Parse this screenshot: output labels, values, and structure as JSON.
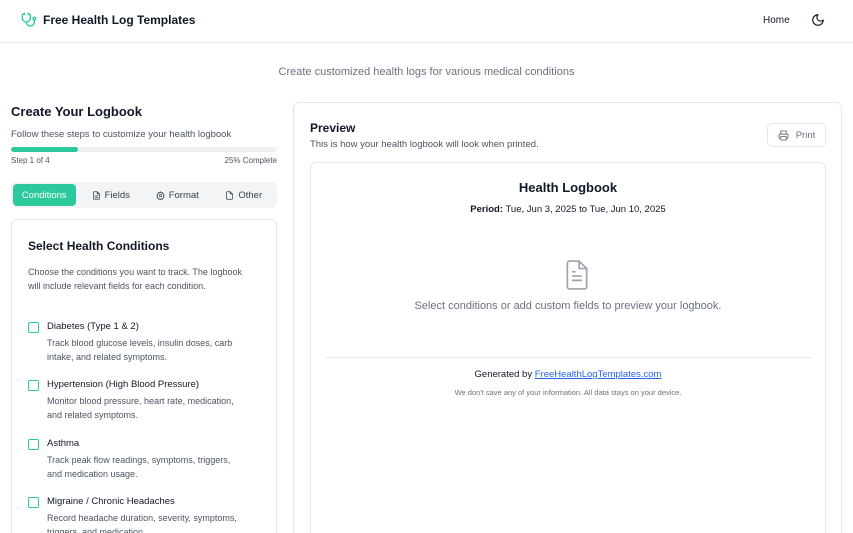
{
  "header": {
    "brand": "Free Health Log Templates",
    "brand_icon": "stethoscope-icon",
    "nav_home": "Home",
    "theme_icon": "moon-icon"
  },
  "subtitle": "Create customized health logs for various medical conditions",
  "builder": {
    "title": "Create Your Logbook",
    "description": "Follow these steps to customize your health logbook",
    "progress": 0.25,
    "step_label": "Step 1 of 4",
    "complete_label": "25% Complete",
    "tabs": [
      {
        "label": "Conditions",
        "icon": "",
        "active": true
      },
      {
        "label": "Fields",
        "icon": "file-icon",
        "active": false
      },
      {
        "label": "Format",
        "icon": "gear-icon",
        "active": false
      },
      {
        "label": "Other",
        "icon": "document-icon",
        "active": false
      }
    ]
  },
  "conditions_card": {
    "title": "Select Health Conditions",
    "description": "Choose the conditions you want to track. The logbook will include relevant fields for each condition.",
    "items": [
      {
        "name": "Diabetes (Type 1 & 2)",
        "desc": "Track blood glucose levels, insulin doses, carb intake, and related symptoms."
      },
      {
        "name": "Hypertension (High Blood Pressure)",
        "desc": "Monitor blood pressure, heart rate, medication, and related symptoms."
      },
      {
        "name": "Asthma",
        "desc": "Track peak flow readings, symptoms, triggers, and medication usage."
      },
      {
        "name": "Migraine / Chronic Headaches",
        "desc": "Record headache duration, severity, symptoms, triggers, and medication."
      }
    ]
  },
  "preview": {
    "title": "Preview",
    "description": "This is how your health logbook will look when printed.",
    "print_label": "Print",
    "logbook": {
      "title": "Health Logbook",
      "period_label": "Period:",
      "period_value": "Tue, Jun 3, 2025 to Tue, Jun 10, 2025",
      "empty_message": "Select conditions or add custom fields to preview your logbook.",
      "generated_by": "Generated by",
      "generated_link": "FreeHealthLogTemplates.com",
      "privacy_note": "We don't save any of your information. All data stays on your device."
    }
  },
  "colors": {
    "accent": "#2bc99b",
    "link": "#2563eb",
    "muted_text": "#6b7280"
  }
}
